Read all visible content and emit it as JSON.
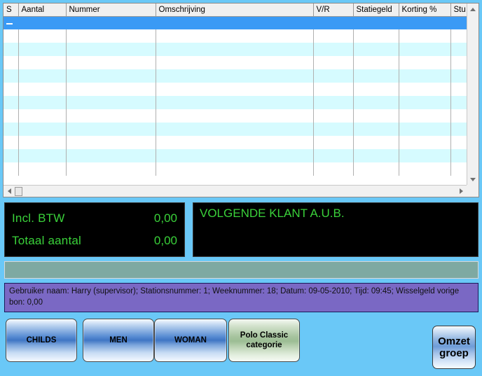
{
  "grid": {
    "columns": [
      {
        "key": "s",
        "label": "S"
      },
      {
        "key": "aantal",
        "label": "Aantal"
      },
      {
        "key": "nummer",
        "label": "Nummer"
      },
      {
        "key": "omschrijving",
        "label": "Omschrijving"
      },
      {
        "key": "vr",
        "label": "V/R"
      },
      {
        "key": "statiegeld",
        "label": "Statiegeld"
      },
      {
        "key": "korting",
        "label": "Korting %"
      },
      {
        "key": "stuk",
        "label": "Stu"
      }
    ],
    "rows": [],
    "selected_row_index": 0,
    "empty_row_count": 12,
    "scrollbar": {
      "vertical_up_icon": "arrow-up-icon",
      "vertical_down_icon": "arrow-down-icon",
      "horizontal_left_icon": "arrow-left-icon",
      "horizontal_right_icon": "arrow-right-icon"
    }
  },
  "totals_display": {
    "lines": [
      {
        "label": "Incl. BTW",
        "value": "0,00"
      },
      {
        "label": "Totaal aantal",
        "value": "0,00"
      }
    ],
    "text_color": "#3ad13a",
    "background_color": "#000000"
  },
  "customer_message_display": {
    "message": "VOLGENDE KLANT A.U.B.",
    "text_color": "#3ad13a",
    "background_color": "#000000"
  },
  "info_bar": {
    "text": "",
    "background_color": "#7ea9a2"
  },
  "status_bar": {
    "text": "Gebruiker naam: Harry (supervisor); Stationsnummer: 1; Weeknummer: 18; Datum: 09-05-2010; Tijd: 09:45; Wisselgeld vorige bon: 0,00",
    "background_color": "#7a68c4"
  },
  "category_buttons": [
    {
      "label": "CHILDS",
      "style": "blue"
    },
    {
      "label": "MEN",
      "style": "blue"
    },
    {
      "label": "WOMAN",
      "style": "blue"
    },
    {
      "label": "Polo Classic categorie",
      "style": "green"
    }
  ],
  "omzet_groep_button": {
    "label": "Omzet groep"
  },
  "theme": {
    "background_color": "#6ac8f7",
    "selection_color": "#3a9af5",
    "row_stripe_color": "#d6fbff"
  }
}
